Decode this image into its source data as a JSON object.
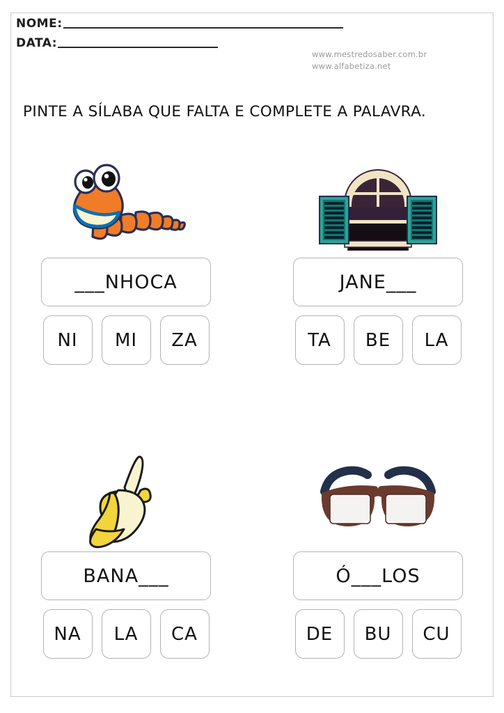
{
  "header": {
    "name_label": "NOME:",
    "date_label": "DATA:",
    "site_1": "www.mestredosaber.com.br",
    "site_2": "www.alfabetiza.net"
  },
  "instruction": "PINTE A SÍLABA QUE FALTA E COMPLETE A PALAVRA.",
  "colors": {
    "page_border": "#c9c9c9",
    "box_border": "#b3b3b3",
    "text": "#111111",
    "site_text": "#9a9a9a",
    "worm_body": "#f07c28",
    "worm_outline": "#2b2f52",
    "worm_mouth": "#0b6fb5",
    "window_shutter": "#2ba496",
    "window_frame": "#efe5c4",
    "window_glass": "#3b2438",
    "banana_peel": "#f2d53c",
    "banana_flesh": "#faf3cf",
    "glasses_frame": "#6b3a2e",
    "glasses_temple": "#22304a"
  },
  "exercises": [
    {
      "id": "minhoca",
      "icon": "worm-illustration",
      "word_prefix": "",
      "word_blank": "___",
      "word_suffix": "NHOCA",
      "word_display": "___NHOCA",
      "syllables": [
        "NI",
        "MI",
        "ZA"
      ]
    },
    {
      "id": "janela",
      "icon": "window-illustration",
      "word_prefix": "JANE",
      "word_blank": "___",
      "word_suffix": "",
      "word_display": "JANE___",
      "syllables": [
        "TA",
        "BE",
        "LA"
      ]
    },
    {
      "id": "banana",
      "icon": "banana-illustration",
      "word_prefix": "BANA",
      "word_blank": "___",
      "word_suffix": "",
      "word_display": "BANA___",
      "syllables": [
        "NA",
        "LA",
        "CA"
      ]
    },
    {
      "id": "oculos",
      "icon": "glasses-illustration",
      "word_prefix": "Ó",
      "word_blank": "___",
      "word_suffix": "LOS",
      "word_display": "Ó___LOS",
      "syllables": [
        "DE",
        "BU",
        "CU"
      ]
    }
  ]
}
